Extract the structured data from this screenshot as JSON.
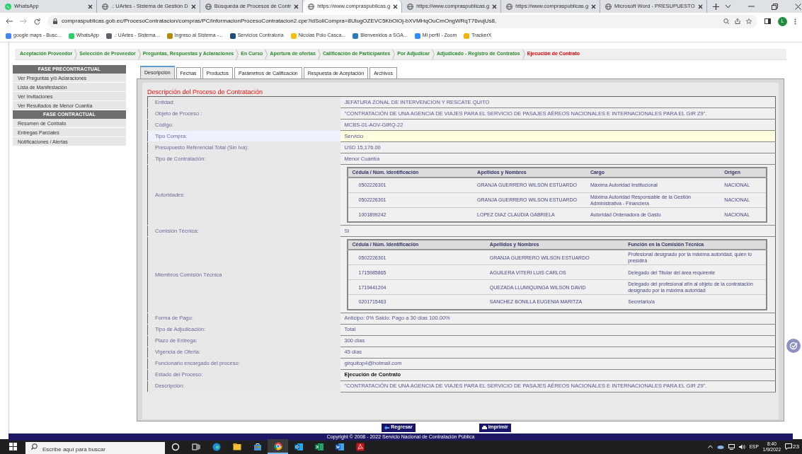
{
  "browser": {
    "tabs": [
      {
        "title": "WhatsApp",
        "selected": false
      },
      {
        "title": ".: UArtes - Sistema de Gestión D",
        "selected": false
      },
      {
        "title": "Búsqueda de Procesos de Contr",
        "selected": false
      },
      {
        "title": "https://www.compraspublicas.g",
        "selected": true
      },
      {
        "title": "https://www.compraspublicas.g",
        "selected": false
      },
      {
        "title": "https://www.compraspublicas.g",
        "selected": false
      },
      {
        "title": "Microsoft Word - PRESUPUESTO",
        "selected": false
      }
    ],
    "address": "compraspublicas.gob.ec/ProcesoContratacion/compras/PC/informacionProcesoContratacion2.cpe?idSoliCompra=8UlugOZEVC5KbOiOj-bXVMHqOuCmOngWRqT76vujUs8,",
    "profile_initial": "L",
    "bookmarks": [
      {
        "title": "google maps - Busc...",
        "color": "#4285f4"
      },
      {
        "title": "WhatsApp",
        "color": "#25d366"
      },
      {
        "title": ".: UArtes - Sistema...",
        "color": "#5f6368"
      },
      {
        "title": "Ingreso al Sistema -...",
        "color": "#b8860b"
      },
      {
        "title": "Servicios Contraloría",
        "color": "#1f4e79"
      },
      {
        "title": "Nicolas Polo Casca...",
        "color": "#fbbc04"
      },
      {
        "title": "Bienvenidos a SGA...",
        "color": "#2a7ab8"
      },
      {
        "title": "Mi perfil - Zoom",
        "color": "#2d8cff"
      },
      {
        "title": "TrackerX",
        "color": "#f0b400"
      }
    ]
  },
  "breadcrumb": [
    {
      "label": "Aceptación Proveedor",
      "selected": false
    },
    {
      "label": "Selección de Proveedor",
      "selected": false
    },
    {
      "label": "Preguntas, Respuestas y Aclaraciones",
      "selected": false
    },
    {
      "label": "En Curso",
      "selected": false
    },
    {
      "label": "Apertura de ofertas",
      "selected": false
    },
    {
      "label": "Calificación de Participantes",
      "selected": false
    },
    {
      "label": "Por Adjudicar",
      "selected": false
    },
    {
      "label": "Adjudicado - Registro de Contratos",
      "selected": false
    },
    {
      "label": "Ejecución de Contrato",
      "selected": true
    }
  ],
  "sidebar": [
    {
      "title": "FASE PRECONTRACTUAL",
      "items": [
        "Ver Preguntas y/ó Aclaraciones",
        "Lista de Manifestación",
        "Ver Invitaciones",
        "Ver Resultados de Menor Cuantía"
      ]
    },
    {
      "title": "FASE CONTRACTUAL",
      "items": [
        "Resumen de Contrato",
        "Entregas Parciales",
        "Notificaciones / Alertas"
      ]
    }
  ],
  "tabs": [
    {
      "label": "Descripción",
      "selected": true
    },
    {
      "label": "Fechas",
      "selected": false
    },
    {
      "label": "Productos",
      "selected": false
    },
    {
      "label": "Parámetros de Calificación",
      "selected": false
    },
    {
      "label": "Respuesta de Aceptación",
      "selected": false
    },
    {
      "label": "Archivos",
      "selected": false
    }
  ],
  "section_title": "Descripción del Proceso de Contratación",
  "fields": [
    {
      "label": "Entidad:",
      "kind": "text",
      "value": "JEFATURA ZONAL DE INTERVENCION Y RESCATE QUITO",
      "highlighted": false,
      "bold": false
    },
    {
      "label": "Objeto de Proceso :",
      "kind": "text",
      "value": "\"CONTRATACIÓN DE UNA AGENCIA DE VIAJES PARA EL SERVICIO DE PASAJES AÉREOS NACIONALES E INTERNACIONALES PARA EL GIR Z9\".",
      "highlighted": false,
      "bold": false
    },
    {
      "label": "Código:",
      "kind": "text",
      "value": "MCBS-01-AGV-GIRQ-22",
      "highlighted": false,
      "bold": false
    },
    {
      "label": "Tipo Compra:",
      "kind": "text",
      "value": "Servicio",
      "highlighted": true,
      "bold": false
    },
    {
      "label": "Presupuesto Referencial Total (Sin Iva):",
      "kind": "text",
      "value": "USD 15,176.00",
      "highlighted": false,
      "bold": false
    },
    {
      "label": "Tipo de Contratación:",
      "kind": "text",
      "value": "Menor Cuantía",
      "highlighted": false,
      "bold": false
    },
    {
      "label": "Autoridades:",
      "kind": "table",
      "table": {
        "columns": [
          "Cédula / Núm. Identificación",
          "Apellidos y Nombres",
          "Cargo",
          "Origen"
        ],
        "rows": [
          [
            "0502226301",
            "GRANJA GUERRERO WILSON ESTUARDO",
            "Máxima Autoridad Institucional",
            "NACIONAL"
          ],
          [
            "0502226301",
            "GRANJA GUERRERO WILSON ESTUARDO",
            "Máxima Autoridad Responsable de la Gestión Administrativa - Financiera",
            "NACIONAL"
          ],
          [
            "1001899242",
            "LOPEZ DIAZ CLAUDIA GABRIELA",
            "Autoridad Ordenadora de Gasto",
            "NACIONAL"
          ]
        ]
      },
      "highlighted": false
    },
    {
      "label": "Comisión Técnica:",
      "kind": "text",
      "value": "Si",
      "highlighted": false,
      "bold": false
    },
    {
      "label": "Miembros Comisión Técnica",
      "kind": "table",
      "table": {
        "columns": [
          "Cédula / Núm. Identificación",
          "Apellidos y Nombres",
          "Función en la Comisión Técnica"
        ],
        "rows": [
          [
            "0502226301",
            "GRANJA GUERRERO WILSON ESTUARDO",
            "Profesional designado por la máxima autoridad, quien lo presidirá"
          ],
          [
            "1715985865",
            "AGUILERA VITERI LUIS CARLOS",
            "Delegado del Titular del área requirente"
          ],
          [
            "1719441204",
            "QUEZADA LLUMIQUINGA WILSON DAVID",
            "Delegado del profesional afín al objeto de la contratación designado por la máxima autoridad"
          ],
          [
            "0201715463",
            "SANCHEZ BONILLA EUGENIA MARITZA",
            "Secretario/a"
          ]
        ]
      },
      "highlighted": false
    },
    {
      "label": "Forma de Pago:",
      "kind": "text",
      "value": "Anticipo: 0% Saldo: Pago a 30 días 100.00%",
      "highlighted": false,
      "bold": false
    },
    {
      "label": "Tipo de Adjudicación:",
      "kind": "text",
      "value": "Total",
      "highlighted": false,
      "bold": false
    },
    {
      "label": "Plazo de Entrega:",
      "kind": "text",
      "value": "300 días",
      "highlighted": false,
      "bold": false
    },
    {
      "label": "Vigencia de Oferta:",
      "kind": "text",
      "value": "45 días",
      "highlighted": false,
      "bold": false
    },
    {
      "label": "Funcionario encargado del proceso:",
      "kind": "text",
      "value": "girquitop4@hotmail.com",
      "highlighted": false,
      "bold": false
    },
    {
      "label": "Estado del Proceso:",
      "kind": "text",
      "value": "Ejecución de Contrato",
      "highlighted": false,
      "bold": true
    },
    {
      "label": "Descripción:",
      "kind": "text",
      "value": "\"CONTRATACIÓN DE UNA AGENCIA DE VIAJES PARA EL SERVICIO DE PASAJES AÉREOS NACIONALES E INTERNACIONALES PARA EL GIR Z9\".",
      "highlighted": false,
      "bold": false
    }
  ],
  "actions": [
    {
      "label": "Regresar",
      "kind": "back"
    },
    {
      "label": "Imprimir",
      "kind": "print"
    }
  ],
  "footer": "Copyright © 2008 - 2022 Servicio Nacional de Contratación Pública",
  "taskbar": {
    "search_placeholder": "Escribe aquí para buscar",
    "apps": [
      {
        "kind": "cortana",
        "active": false
      },
      {
        "kind": "taskview",
        "active": false
      },
      {
        "kind": "edge",
        "active": false
      },
      {
        "kind": "explorer",
        "active": false
      },
      {
        "kind": "store",
        "active": false
      },
      {
        "kind": "chrome",
        "active": true
      },
      {
        "kind": "outlook",
        "active": false
      },
      {
        "kind": "excel",
        "active": false
      },
      {
        "kind": "word",
        "active": false
      },
      {
        "kind": "acrobat",
        "active": false
      }
    ],
    "language": "ESP",
    "time": "8:40",
    "date": "1/9/2022",
    "notifications": "23"
  }
}
